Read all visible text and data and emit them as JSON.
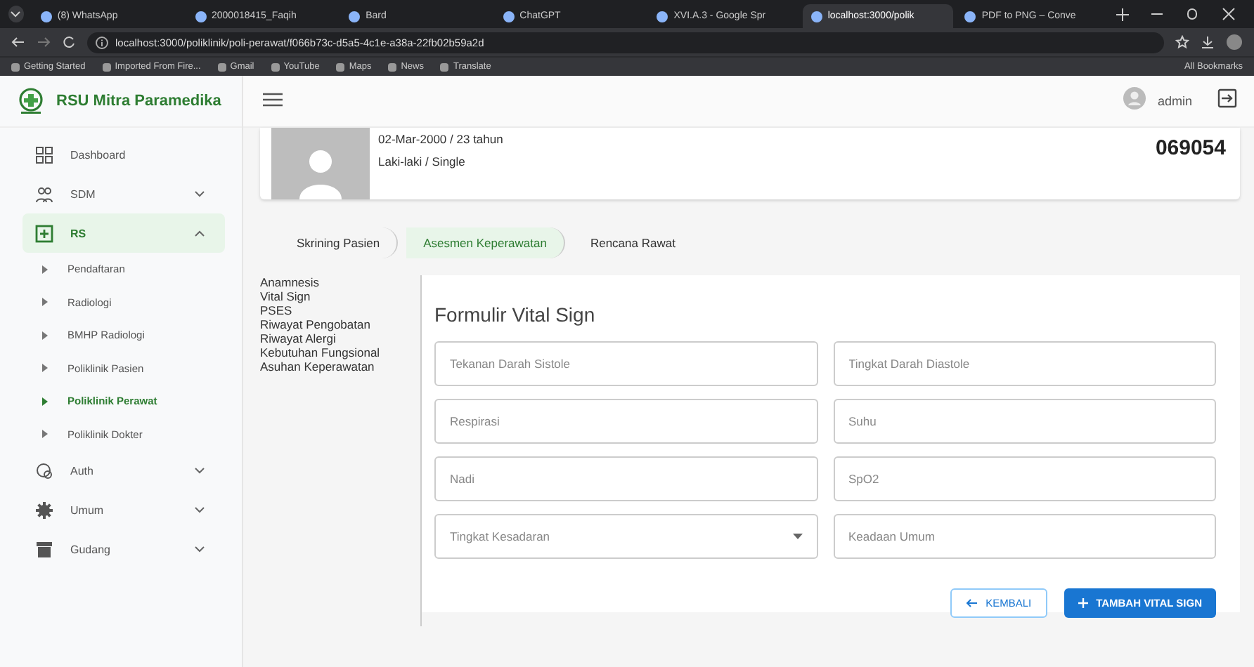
{
  "browser": {
    "tabs": [
      {
        "label": "(8) WhatsApp",
        "selected": false
      },
      {
        "label": "2000018415_Faqih",
        "selected": false
      },
      {
        "label": "Bard",
        "selected": false
      },
      {
        "label": "ChatGPT",
        "selected": false
      },
      {
        "label": "XVI.A.3 - Google Spr",
        "selected": false
      },
      {
        "label": "localhost:3000/polik",
        "selected": true
      },
      {
        "label": "PDF to PNG – Conve",
        "selected": false
      }
    ],
    "url": "localhost:3000/poliklinik/poli-perawat/f066b73c-d5a5-4c1e-a38a-22fb02b59a2d",
    "bookmarks": [
      "Getting Started",
      "Imported From Fire...",
      "Gmail",
      "YouTube",
      "Maps",
      "News",
      "Translate"
    ],
    "all_bookmarks": "All Bookmarks"
  },
  "app": {
    "brand": "RSU Mitra Paramedika",
    "user": "admin"
  },
  "sidebar": {
    "items": [
      {
        "label": "Dashboard",
        "kind": "link",
        "selected": false
      },
      {
        "label": "SDM",
        "kind": "group",
        "expanded": false,
        "selected": false
      },
      {
        "label": "RS",
        "kind": "group",
        "expanded": true,
        "selected": true,
        "children": [
          {
            "label": "Pendaftaran",
            "selected": false
          },
          {
            "label": "Radiologi",
            "selected": false
          },
          {
            "label": "BMHP Radiologi",
            "selected": false
          },
          {
            "label": "Poliklinik Pasien",
            "selected": false
          },
          {
            "label": "Poliklinik Perawat",
            "selected": true
          },
          {
            "label": "Poliklinik Dokter",
            "selected": false
          }
        ]
      },
      {
        "label": "Auth",
        "kind": "group",
        "expanded": false,
        "selected": false
      },
      {
        "label": "Umum",
        "kind": "group",
        "expanded": false,
        "selected": false
      },
      {
        "label": "Gudang",
        "kind": "group",
        "expanded": false,
        "selected": false
      }
    ]
  },
  "patient": {
    "birth": "02-Mar-2000 / 23 tahun",
    "gender": "Laki-laki / Single",
    "number": "069054"
  },
  "steps": [
    {
      "label": "Skrining Pasien",
      "selected": false
    },
    {
      "label": "Asesmen Keperawatan",
      "selected": true
    },
    {
      "label": "Rencana Rawat",
      "selected": false
    }
  ],
  "section_menu": [
    "Anamnesis",
    "Vital Sign",
    "PSES",
    "Riwayat Pengobatan",
    "Riwayat Alergi",
    "Kebutuhan Fungsional",
    "Asuhan Keperawatan"
  ],
  "form": {
    "title": "Formulir Vital Sign",
    "fields": [
      {
        "placeholder": "Tekanan Darah Sistole",
        "kind": "text"
      },
      {
        "placeholder": "Tingkat Darah Diastole",
        "kind": "text"
      },
      {
        "placeholder": "Respirasi",
        "kind": "text"
      },
      {
        "placeholder": "Suhu",
        "kind": "text"
      },
      {
        "placeholder": "Nadi",
        "kind": "text"
      },
      {
        "placeholder": "SpO2",
        "kind": "text"
      },
      {
        "placeholder": "Tingkat Kesadaran",
        "kind": "select"
      },
      {
        "placeholder": "Keadaan Umum",
        "kind": "text"
      }
    ],
    "back_button": "KEMBALI",
    "submit_button": "TAMBAH VITAL SIGN"
  }
}
